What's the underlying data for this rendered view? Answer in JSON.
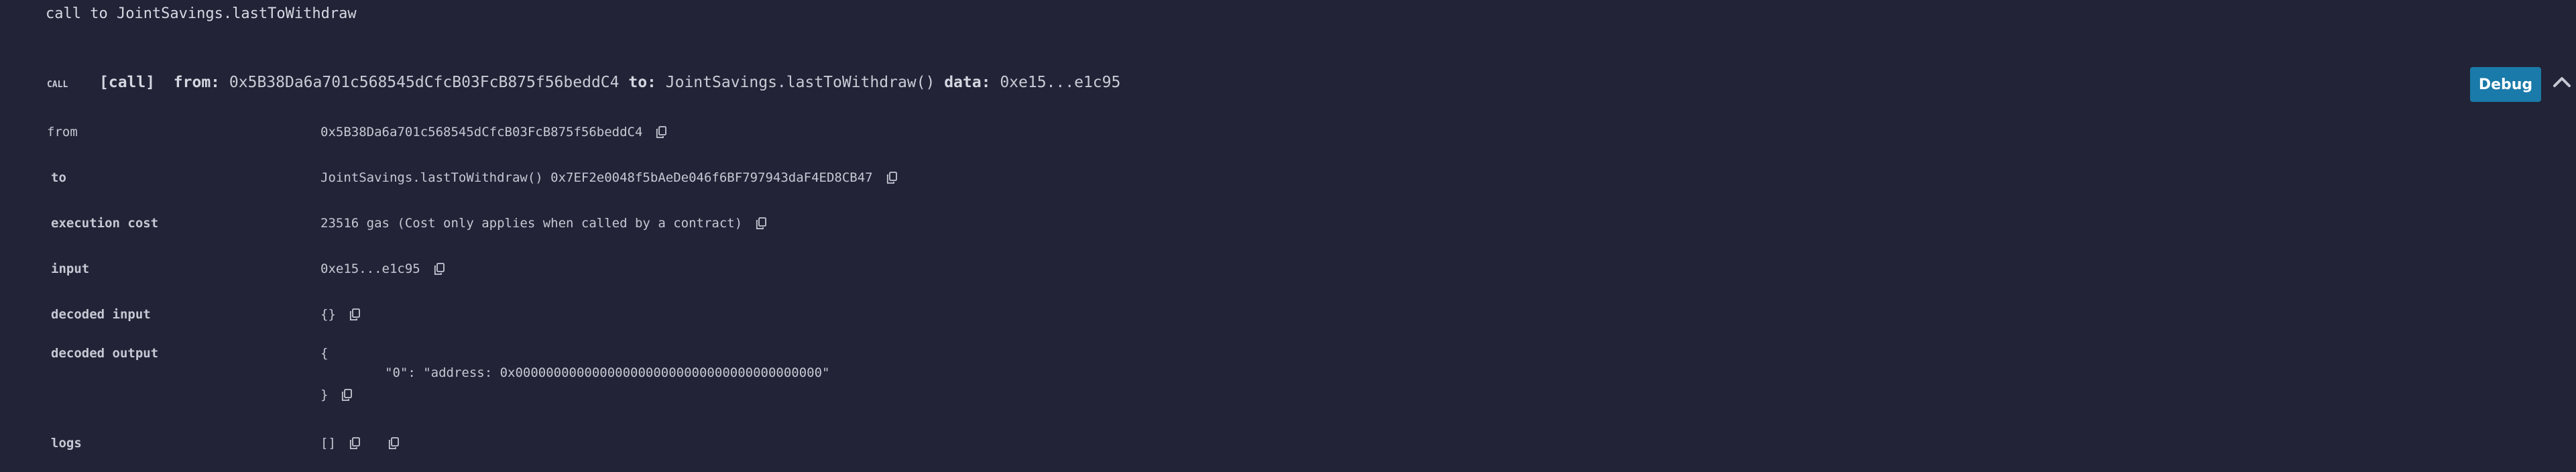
{
  "title": "call to JointSavings.lastToWithdraw",
  "header": {
    "call_tag": "CALL",
    "call_kind": "[call]",
    "from_label": "from:",
    "from_value": "0x5B38Da6a701c568545dCfcB03FcB875f56beddC4",
    "to_label": "to:",
    "to_value": "JointSavings.lastToWithdraw()",
    "data_label": "data:",
    "data_value": "0xe15...e1c95",
    "debug_label": "Debug"
  },
  "rows": {
    "from": {
      "label": "from",
      "value": "0x5B38Da6a701c568545dCfcB03FcB875f56beddC4"
    },
    "to": {
      "label": "to",
      "value": "JointSavings.lastToWithdraw() 0x7EF2e0048f5bAeDe046f6BF797943daF4ED8CB47"
    },
    "execution_cost": {
      "label": "execution cost",
      "value": "23516 gas (Cost only applies when called by a contract)"
    },
    "input": {
      "label": "input",
      "value": "0xe15...e1c95"
    },
    "decoded_input": {
      "label": "decoded input",
      "value": "{}"
    },
    "decoded_output": {
      "label": "decoded output",
      "open": "{",
      "entry": "\"0\": \"address: 0x0000000000000000000000000000000000000000\"",
      "close": "}"
    },
    "logs": {
      "label": "logs",
      "value": "[]"
    }
  },
  "icons": {
    "copy": "copy-icon",
    "caret": "chevron-up-icon"
  },
  "colors": {
    "background": "#222336",
    "text": "#c6c8d4",
    "debug_button": "#1a7aa9"
  }
}
